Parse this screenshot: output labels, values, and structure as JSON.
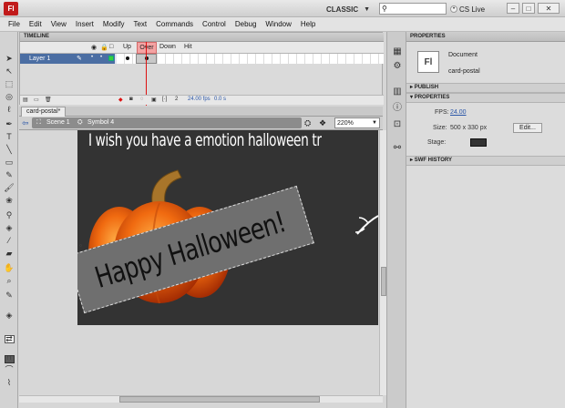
{
  "app": {
    "logo": "Fl",
    "workspace": "CLASSIC",
    "search_placeholder": "",
    "cslive": "CS Live"
  },
  "menu": [
    "File",
    "Edit",
    "View",
    "Insert",
    "Modify",
    "Text",
    "Commands",
    "Control",
    "Debug",
    "Window",
    "Help"
  ],
  "timeline": {
    "title": "TIMELINE",
    "frames": [
      "Up",
      "Over",
      "Down",
      "Hit"
    ],
    "layer_name": "Layer 1",
    "status_frame": "2",
    "status_fps": "24.00 fps",
    "status_time": "0.0 s"
  },
  "document": {
    "tab_name": "card-postal*",
    "scene": "Scene 1",
    "symbol": "Symbol 4",
    "zoom": "220%"
  },
  "stage": {
    "headline": "I wish you have a emotion halloween tr",
    "banner_text": "Happy Halloween!"
  },
  "properties": {
    "title": "PROPERTIES",
    "doc_icon": "Fl",
    "doc_type": "Document",
    "doc_name": "card-postal",
    "publish_section": "PUBLISH",
    "properties_section": "PROPERTIES",
    "fps_label": "FPS:",
    "fps_value": "24.00",
    "size_label": "Size:",
    "size_value": "500 x 330 px",
    "edit_button": "Edit...",
    "stage_label": "Stage:",
    "swf_section": "SWF HISTORY"
  },
  "colors": {
    "stage_bg": "#333333",
    "layer_selected": "#4b6ea3",
    "over_frame": "#f4a3a3",
    "playhead": "#dd1111"
  }
}
